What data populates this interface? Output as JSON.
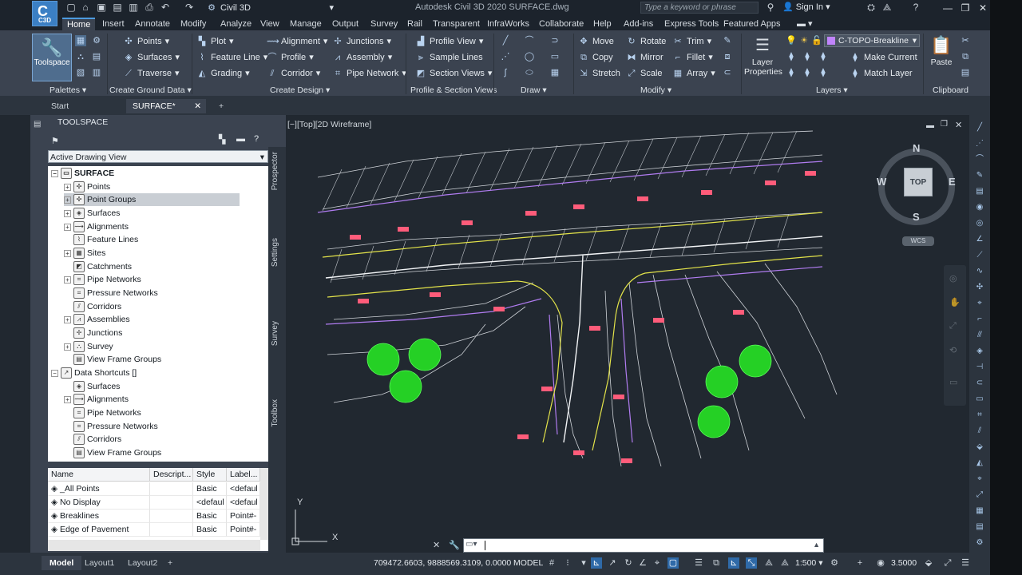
{
  "titlebar": {
    "app_logo": "C3D",
    "workspace": "Civil 3D",
    "title": "Autodesk Civil 3D 2020    SURFACE.dwg",
    "search_placeholder": "Type a keyword or phrase",
    "sign_in": "Sign In"
  },
  "ribbon_tabs": [
    "Home",
    "Insert",
    "Annotate",
    "Modify",
    "Analyze",
    "View",
    "Manage",
    "Output",
    "Survey",
    "Rail",
    "Transparent",
    "InfraWorks",
    "Collaborate",
    "Help",
    "Add-ins",
    "Express Tools",
    "Featured Apps"
  ],
  "ribbon": {
    "toolspace": "Toolspace",
    "palettes": "Palettes",
    "ground": {
      "points": "Points",
      "surfaces": "Surfaces",
      "traverse": "Traverse",
      "label": "Create Ground Data"
    },
    "design": {
      "plot": "Plot",
      "feature_line": "Feature Line",
      "grading": "Grading",
      "alignment": "Alignment",
      "profile": "Profile",
      "corridor": "Corridor",
      "junctions": "Junctions",
      "assembly": "Assembly",
      "pipe_network": "Pipe Network",
      "label": "Create Design"
    },
    "profile_section": {
      "profile_view": "Profile View",
      "sample_lines": "Sample Lines",
      "section_views": "Section Views",
      "label": "Profile & Section Views"
    },
    "draw_label": "Draw",
    "modify": {
      "move": "Move",
      "copy": "Copy",
      "stretch": "Stretch",
      "rotate": "Rotate",
      "mirror": "Mirror",
      "scale": "Scale",
      "trim": "Trim",
      "fillet": "Fillet",
      "array": "Array",
      "label": "Modify"
    },
    "layers": {
      "layer_properties": "Layer Properties",
      "current_layer": "C-TOPO-Breakline",
      "make_current": "Make Current",
      "match_layer": "Match Layer",
      "label": "Layers"
    },
    "clipboard": {
      "paste": "Paste",
      "label": "Clipboard"
    }
  },
  "doc_tabs": {
    "start": "Start",
    "surface": "SURFACE*"
  },
  "toolspace": {
    "title": "TOOLSPACE",
    "view": "Active Drawing View",
    "tree": [
      "SURFACE",
      "Points",
      "Point Groups",
      "Surfaces",
      "Alignments",
      "Feature Lines",
      "Sites",
      "Catchments",
      "Pipe Networks",
      "Pressure Networks",
      "Corridors",
      "Assemblies",
      "Junctions",
      "Survey",
      "View Frame Groups",
      "Data Shortcuts []",
      "Surfaces",
      "Alignments",
      "Pipe Networks",
      "Pressure Networks",
      "Corridors",
      "View Frame Groups"
    ],
    "side_tabs": [
      "Prospector",
      "Settings",
      "Survey",
      "Toolbox"
    ],
    "table_headers": [
      "Name",
      "Descript...",
      "Style",
      "Label..."
    ],
    "table_rows": [
      [
        "_All Points",
        "",
        "Basic",
        "<defaul"
      ],
      [
        "No Display",
        "",
        "<defaul",
        "<defaul"
      ],
      [
        "Breaklines",
        "",
        "Basic",
        "Point#-"
      ],
      [
        "Edge of Pavement",
        "",
        "Basic",
        "Point#-"
      ]
    ]
  },
  "viewport": {
    "label": "[−][Top][2D Wireframe]",
    "viewcube": {
      "top": "TOP",
      "n": "N",
      "s": "S",
      "e": "E",
      "w": "W",
      "wcs": "WCS"
    },
    "ucs_x": "X",
    "ucs_y": "Y"
  },
  "statusbar": {
    "tabs": [
      "Model",
      "Layout1",
      "Layout2"
    ],
    "coords": "709472.6603, 9888569.3109, 0.0000",
    "model": "MODEL",
    "scale": "1:500",
    "lineweight": "3.5000"
  }
}
